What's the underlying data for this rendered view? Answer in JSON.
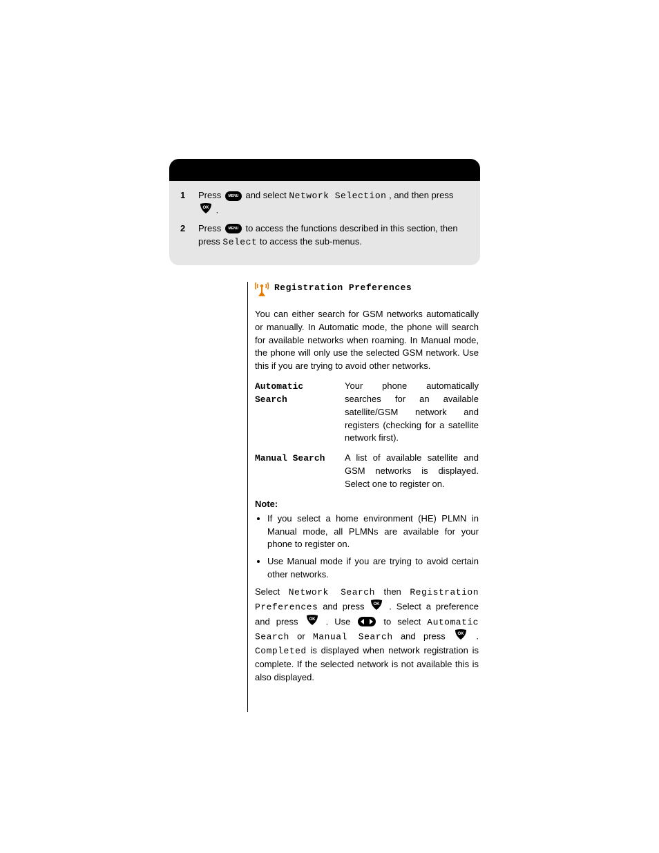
{
  "box": {
    "step1": {
      "num": "1",
      "pre": "Press ",
      "menu": "MENU",
      "mid": " and select ",
      "label": "Network Selection",
      "post": ", and then press ",
      "end": "."
    },
    "step2": {
      "num": "2",
      "pre": "Press ",
      "menu": "MENU",
      "mid": " to access the functions described in this section, then press ",
      "label": "Select",
      "end2": " to access the sub-menus."
    }
  },
  "section": {
    "title": "Registration Preferences",
    "intro": "You can either search for GSM networks automatically or manually. In Automatic mode, the phone will search for available networks when roaming. In Manual mode, the phone will only use the selected GSM network. Use this if you are trying to avoid other networks.",
    "items": [
      {
        "label": "Automatic Search",
        "text": "Your phone automatically searches for an available satellite/GSM network and registers (checking for a satellite network first)."
      },
      {
        "label": "Manual Search",
        "text": "A list of available satellite and GSM networks is displayed. Select one to register on."
      }
    ],
    "note": {
      "head": "Note:",
      "bullets": [
        "If you select a home environment (HE) PLMN in Manual mode, all PLMNs are available for your phone to register on.",
        "Use Manual mode if you are trying to avoid certain other networks."
      ]
    },
    "flow": {
      "p1": "Select ",
      "p1_label": "Network Search",
      "p2": " then ",
      "p2_label": "Registration Preferences",
      "p3": " and press ",
      "p4": ". Select a preference and press ",
      "p5": ". Use ",
      "p6": " to select ",
      "p6_label1": "Automatic Search",
      "p7": " or ",
      "p6_label2": "Manual Search",
      "p8": " and press ",
      "p9": ". ",
      "p9_label": "Completed",
      "p10": " is displayed when network registration is complete. If the selected network is not available this is also displayed."
    }
  }
}
